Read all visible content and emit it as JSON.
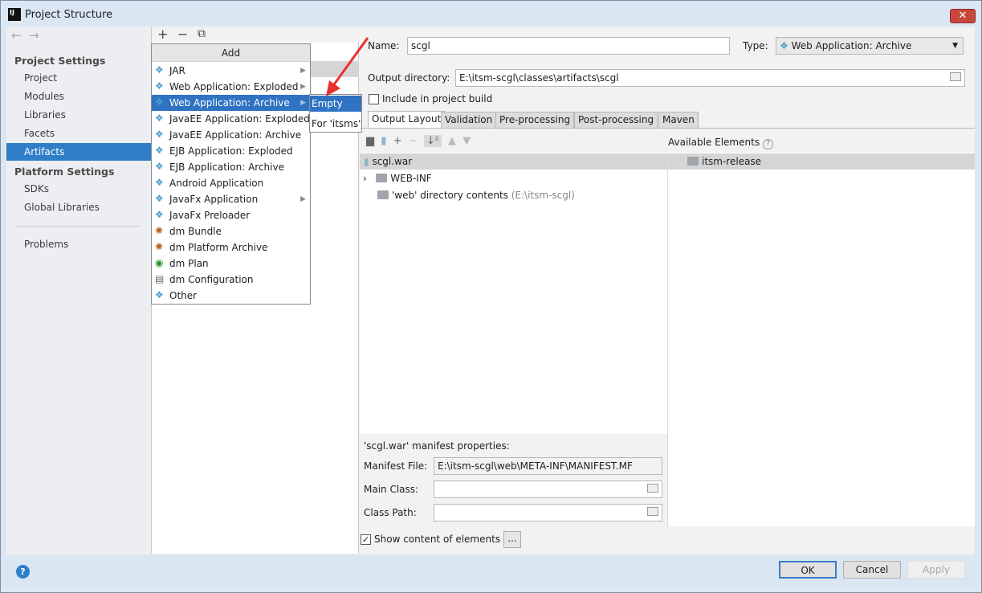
{
  "window": {
    "title": "Project Structure",
    "logo": "IJ",
    "close": "✕"
  },
  "sidebar": {
    "nav_back": "←",
    "nav_forward": "→",
    "project_settings": "Project Settings",
    "items": [
      "Project",
      "Modules",
      "Libraries",
      "Facets",
      "Artifacts"
    ],
    "platform_settings": "Platform Settings",
    "platform_items": [
      "SDKs",
      "Global Libraries"
    ],
    "problems": "Problems",
    "selected": "Artifacts"
  },
  "toolbar": {
    "add": "+",
    "remove": "−",
    "copy": "⧉"
  },
  "add_menu": {
    "title": "Add",
    "items": [
      {
        "label": "JAR",
        "icon": "jar-icon",
        "submenu": true
      },
      {
        "label": "Web Application: Exploded",
        "icon": "web-app-icon",
        "submenu": true
      },
      {
        "label": "Web Application: Archive",
        "icon": "web-app-icon",
        "submenu": true,
        "selected": true
      },
      {
        "label": "JavaEE Application: Exploded",
        "icon": "javaee-icon"
      },
      {
        "label": "JavaEE Application: Archive",
        "icon": "javaee-icon"
      },
      {
        "label": "EJB Application: Exploded",
        "icon": "ejb-icon"
      },
      {
        "label": "EJB Application: Archive",
        "icon": "ejb-icon"
      },
      {
        "label": "Android Application",
        "icon": "android-icon"
      },
      {
        "label": "JavaFx Application",
        "icon": "javafx-icon",
        "submenu": true
      },
      {
        "label": "JavaFx Preloader",
        "icon": "javafx-icon"
      },
      {
        "label": "dm Bundle",
        "icon": "dm-bundle-icon"
      },
      {
        "label": "dm Platform Archive",
        "icon": "dm-bundle-icon"
      },
      {
        "label": "dm Plan",
        "icon": "dm-plan-icon"
      },
      {
        "label": "dm Configuration",
        "icon": "dm-config-icon"
      },
      {
        "label": "Other",
        "icon": "other-icon"
      }
    ],
    "submenu": [
      "Empty",
      "For 'itsms'"
    ]
  },
  "form": {
    "name_label": "Name:",
    "name_value": "scgl",
    "type_label": "Type:",
    "type_value": "Web Application: Archive",
    "output_label": "Output directory:",
    "output_value": "E:\\itsm-scgl\\classes\\artifacts\\scgl",
    "include_label": "Include in project build",
    "include_checked": false
  },
  "tabs": [
    "Output Layout",
    "Validation",
    "Pre-processing",
    "Post-processing",
    "Maven"
  ],
  "active_tab": "Output Layout",
  "layout": {
    "root": "scgl.war",
    "children": [
      {
        "label": "WEB-INF",
        "expandable": true
      },
      {
        "label": "'web' directory contents",
        "hint": "(E:\\itsm-scgl)"
      }
    ]
  },
  "available": {
    "title": "Available Elements",
    "help": "?",
    "items": [
      "itsm-release"
    ]
  },
  "manifest": {
    "title": "'scgl.war' manifest properties:",
    "file_label": "Manifest File:",
    "file_value": "E:\\itsm-scgl\\web\\META-INF\\MANIFEST.MF",
    "main_label": "Main Class:",
    "main_value": "",
    "cp_label": "Class Path:",
    "cp_value": ""
  },
  "show_content": {
    "label": "Show content of elements",
    "checked": true,
    "more": "..."
  },
  "buttons": {
    "ok": "OK",
    "cancel": "Cancel",
    "apply": "Apply",
    "help": "?"
  },
  "colors": {
    "selection": "#2f73c2",
    "annotation_arrow": "#e8312f"
  }
}
